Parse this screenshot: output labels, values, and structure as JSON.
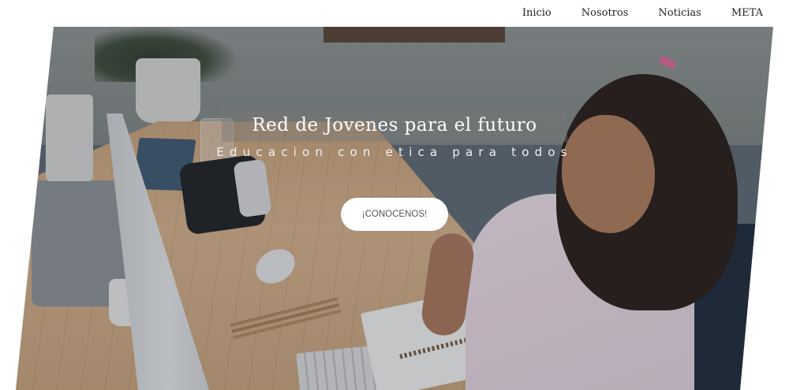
{
  "nav": {
    "items": [
      {
        "label": "Inicio"
      },
      {
        "label": "Nosotros"
      },
      {
        "label": "Noticias"
      },
      {
        "label": "META"
      }
    ]
  },
  "hero": {
    "title": "Red de Jovenes para el futuro",
    "subtitle": "Educacion con etica para todos",
    "cta_label": "¡CONOCENOS!",
    "image": "girl-studying-at-desk-with-computer"
  }
}
